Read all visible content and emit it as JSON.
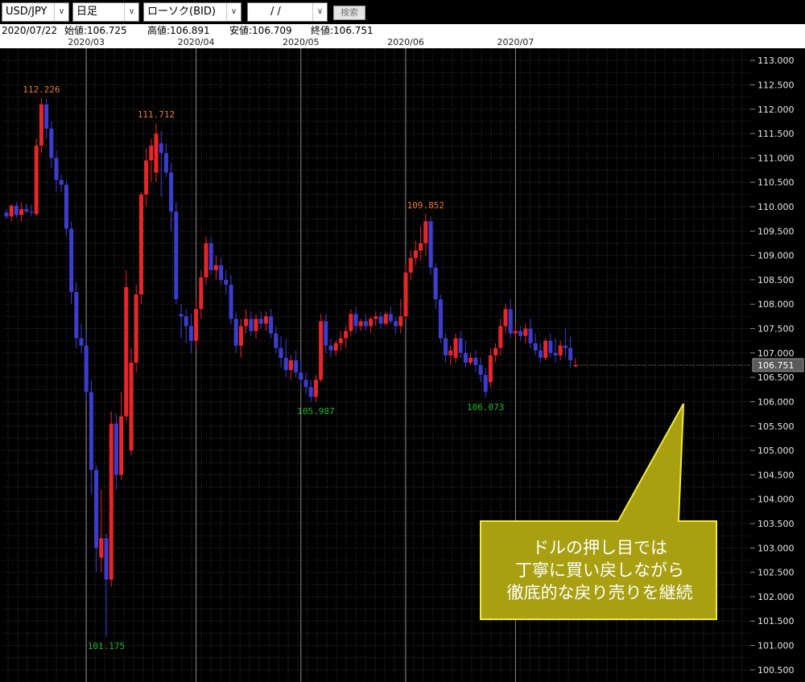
{
  "toolbar": {
    "symbol": "USD/JPY",
    "timeframe": "日足",
    "chart_style": "ローソク(BID)",
    "date_value": "/ /",
    "search_label": "検索"
  },
  "ohlc_bar": {
    "date": "2020/07/22",
    "open": "始値:106.725",
    "high": "高値:106.891",
    "low": "安値:106.709",
    "close": "終値:106.751"
  },
  "colors": {
    "background": "#000000",
    "grid": "#3a3a3a",
    "up_candle": "#e8262a",
    "down_candle": "#3c3ccf",
    "peak_label": "#e57a2c",
    "trough_label": "#28b628",
    "callout_fill": "#a8a010",
    "callout_border": "#f0ea3c",
    "callout_text": "#ffffff"
  },
  "callout": {
    "lines": [
      "ドルの押し目では",
      "丁寧に買い戻しながら",
      "徹底的な戻り売りを継続"
    ]
  },
  "chart_data": {
    "type": "candlestick",
    "symbol": "USD/JPY",
    "timeframe": "daily",
    "y_range": [
      100.25,
      113.25
    ],
    "y_ticks": [
      "113.000",
      "112.500",
      "112.000",
      "111.500",
      "111.000",
      "110.500",
      "110.000",
      "109.500",
      "109.000",
      "108.500",
      "108.000",
      "107.500",
      "107.000",
      "106.500",
      "106.000",
      "105.500",
      "105.000",
      "104.500",
      "104.000",
      "103.500",
      "103.000",
      "102.500",
      "102.000",
      "101.500",
      "101.000",
      "100.500"
    ],
    "month_labels": [
      {
        "label": "2020/03",
        "index": 16
      },
      {
        "label": "2020/04",
        "index": 38
      },
      {
        "label": "2020/05",
        "index": 59
      },
      {
        "label": "2020/06",
        "index": 80
      },
      {
        "label": "2020/07",
        "index": 102
      }
    ],
    "current_price": "106.751",
    "annotations": [
      {
        "label": "112.226",
        "kind": "peak",
        "index": 7,
        "value": 112.226
      },
      {
        "label": "111.712",
        "kind": "peak",
        "index": 30,
        "value": 111.712
      },
      {
        "label": "101.175",
        "kind": "trough",
        "index": 20,
        "value": 101.175
      },
      {
        "label": "105.987",
        "kind": "trough",
        "index": 62,
        "value": 105.987
      },
      {
        "label": "109.852",
        "kind": "peak",
        "index": 84,
        "value": 109.852
      },
      {
        "label": "106.073",
        "kind": "trough",
        "index": 96,
        "value": 106.073
      }
    ],
    "candles": [
      [
        109.88,
        109.95,
        109.75,
        109.8
      ],
      [
        109.8,
        110.05,
        109.7,
        110.02
      ],
      [
        110.02,
        110.1,
        109.78,
        109.83
      ],
      [
        109.83,
        110.08,
        109.7,
        109.95
      ],
      [
        109.95,
        110.06,
        109.86,
        109.9
      ],
      [
        109.9,
        110.04,
        109.8,
        109.88
      ],
      [
        109.85,
        111.4,
        109.8,
        111.25
      ],
      [
        111.25,
        112.226,
        111.1,
        112.1
      ],
      [
        112.1,
        112.22,
        111.4,
        111.6
      ],
      [
        111.6,
        111.75,
        110.8,
        111.0
      ],
      [
        111.0,
        111.15,
        110.3,
        110.55
      ],
      [
        110.55,
        110.65,
        110.3,
        110.45
      ],
      [
        110.45,
        110.55,
        109.4,
        109.55
      ],
      [
        109.55,
        109.7,
        108.0,
        108.25
      ],
      [
        108.25,
        108.45,
        107.1,
        107.3
      ],
      [
        107.3,
        107.6,
        107.0,
        107.15
      ],
      [
        107.15,
        107.45,
        106.0,
        106.2
      ],
      [
        106.2,
        106.45,
        104.1,
        104.6
      ],
      [
        104.6,
        104.7,
        102.5,
        103.0
      ],
      [
        102.8,
        104.2,
        102.5,
        103.2
      ],
      [
        103.2,
        103.3,
        101.175,
        102.35
      ],
      [
        102.35,
        105.8,
        102.2,
        105.55
      ],
      [
        105.55,
        105.75,
        104.2,
        104.5
      ],
      [
        104.5,
        106.2,
        104.4,
        105.7
      ],
      [
        105.7,
        108.7,
        105.6,
        108.35
      ],
      [
        105.0,
        107.1,
        104.9,
        106.8
      ],
      [
        106.8,
        108.4,
        106.6,
        108.2
      ],
      [
        108.2,
        110.3,
        108.0,
        110.25
      ],
      [
        110.25,
        111.2,
        110.0,
        110.95
      ],
      [
        110.95,
        111.4,
        110.5,
        111.25
      ],
      [
        110.7,
        111.712,
        110.5,
        111.5
      ],
      [
        111.3,
        111.55,
        110.2,
        111.1
      ],
      [
        111.1,
        111.3,
        110.6,
        110.7
      ],
      [
        110.7,
        110.9,
        109.5,
        109.9
      ],
      [
        109.9,
        110.1,
        108.0,
        108.1
      ],
      [
        107.8,
        108.0,
        107.3,
        107.75
      ],
      [
        107.75,
        107.9,
        107.2,
        107.55
      ],
      [
        107.55,
        107.8,
        107.0,
        107.25
      ],
      [
        107.25,
        108.1,
        107.1,
        107.9
      ],
      [
        107.9,
        108.7,
        107.7,
        108.55
      ],
      [
        108.55,
        109.4,
        108.4,
        109.25
      ],
      [
        109.25,
        109.4,
        108.6,
        108.7
      ],
      [
        108.7,
        109.0,
        108.5,
        108.8
      ],
      [
        108.8,
        108.95,
        108.4,
        108.5
      ],
      [
        108.5,
        108.7,
        108.2,
        108.4
      ],
      [
        108.4,
        108.6,
        107.6,
        107.7
      ],
      [
        107.7,
        107.85,
        107.0,
        107.15
      ],
      [
        107.15,
        107.7,
        106.9,
        107.55
      ],
      [
        107.55,
        107.9,
        107.4,
        107.7
      ],
      [
        107.7,
        107.85,
        107.35,
        107.45
      ],
      [
        107.45,
        107.8,
        107.3,
        107.7
      ],
      [
        107.7,
        107.85,
        107.5,
        107.6
      ],
      [
        107.6,
        107.85,
        107.45,
        107.75
      ],
      [
        107.75,
        107.9,
        107.3,
        107.4
      ],
      [
        107.4,
        107.55,
        107.0,
        107.1
      ],
      [
        107.1,
        107.35,
        106.7,
        106.9
      ],
      [
        106.9,
        107.3,
        106.5,
        106.65
      ],
      [
        106.65,
        106.95,
        106.45,
        106.85
      ],
      [
        106.85,
        107.05,
        106.5,
        106.6
      ],
      [
        106.6,
        106.85,
        106.35,
        106.45
      ],
      [
        106.45,
        106.6,
        106.15,
        106.3
      ],
      [
        106.3,
        106.45,
        105.987,
        106.1
      ],
      [
        106.1,
        106.55,
        106.0,
        106.45
      ],
      [
        106.45,
        107.8,
        106.4,
        107.65
      ],
      [
        107.65,
        107.8,
        107.0,
        107.15
      ],
      [
        107.15,
        107.3,
        106.9,
        107.05
      ],
      [
        107.05,
        107.25,
        106.95,
        107.2
      ],
      [
        107.2,
        107.45,
        107.05,
        107.3
      ],
      [
        107.3,
        107.55,
        107.1,
        107.45
      ],
      [
        107.45,
        107.9,
        107.35,
        107.8
      ],
      [
        107.8,
        107.95,
        107.4,
        107.55
      ],
      [
        107.55,
        107.7,
        107.45,
        107.65
      ],
      [
        107.65,
        107.8,
        107.45,
        107.55
      ],
      [
        107.55,
        107.75,
        107.4,
        107.7
      ],
      [
        107.7,
        107.85,
        107.55,
        107.75
      ],
      [
        107.75,
        107.85,
        107.5,
        107.6
      ],
      [
        107.6,
        107.85,
        107.55,
        107.8
      ],
      [
        107.8,
        107.95,
        107.6,
        107.65
      ],
      [
        107.65,
        107.75,
        107.4,
        107.55
      ],
      [
        107.55,
        108.1,
        107.4,
        107.75
      ],
      [
        107.75,
        108.8,
        107.7,
        108.65
      ],
      [
        108.65,
        109.1,
        108.5,
        108.95
      ],
      [
        108.95,
        109.3,
        108.8,
        109.1
      ],
      [
        109.1,
        109.6,
        108.9,
        109.25
      ],
      [
        109.25,
        109.852,
        109.0,
        109.7
      ],
      [
        109.7,
        109.8,
        108.6,
        108.75
      ],
      [
        108.75,
        108.85,
        107.9,
        108.1
      ],
      [
        108.1,
        108.2,
        107.2,
        107.3
      ],
      [
        107.3,
        107.4,
        106.8,
        106.95
      ],
      [
        106.95,
        107.15,
        106.75,
        107.05
      ],
      [
        106.9,
        107.4,
        106.8,
        107.3
      ],
      [
        107.3,
        107.45,
        106.9,
        107.0
      ],
      [
        107.0,
        107.25,
        106.7,
        106.8
      ],
      [
        106.8,
        107.0,
        106.75,
        106.9
      ],
      [
        106.9,
        107.05,
        106.6,
        106.75
      ],
      [
        106.75,
        106.9,
        106.4,
        106.55
      ],
      [
        106.55,
        106.7,
        106.073,
        106.2
      ],
      [
        106.4,
        107.1,
        106.3,
        106.95
      ],
      [
        106.95,
        107.2,
        106.8,
        107.1
      ],
      [
        107.1,
        107.7,
        106.95,
        107.55
      ],
      [
        107.55,
        108.0,
        107.4,
        107.9
      ],
      [
        107.9,
        108.1,
        107.3,
        107.4
      ],
      [
        107.4,
        107.6,
        107.3,
        107.45
      ],
      [
        107.45,
        107.55,
        107.25,
        107.35
      ],
      [
        107.35,
        107.6,
        107.2,
        107.5
      ],
      [
        107.5,
        107.7,
        107.1,
        107.2
      ],
      [
        107.2,
        107.4,
        106.95,
        107.05
      ],
      [
        107.05,
        107.2,
        106.8,
        106.9
      ],
      [
        106.9,
        107.3,
        106.85,
        107.25
      ],
      [
        107.25,
        107.4,
        106.9,
        107.0
      ],
      [
        107.0,
        107.3,
        106.8,
        106.95
      ],
      [
        106.95,
        107.25,
        106.85,
        107.15
      ],
      [
        107.15,
        107.5,
        106.9,
        107.1
      ],
      [
        107.1,
        107.35,
        106.7,
        106.85
      ],
      [
        106.725,
        106.891,
        106.709,
        106.751
      ]
    ]
  }
}
